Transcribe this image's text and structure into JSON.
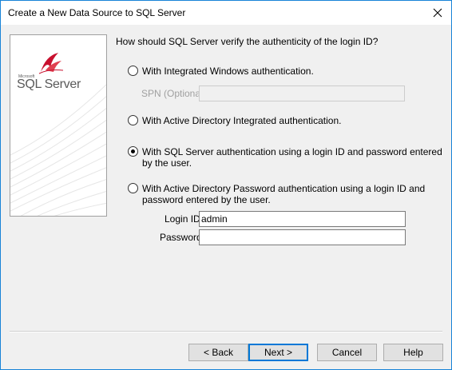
{
  "window": {
    "title": "Create a New Data Source to SQL Server"
  },
  "logo": {
    "small_text": "Microsoft",
    "product_text": "SQL Server"
  },
  "question": "How should SQL Server verify the authenticity of the login ID?",
  "options": [
    {
      "label": "With Integrated Windows authentication.",
      "checked": false
    },
    {
      "label": "With Active Directory Integrated authentication.",
      "checked": false
    },
    {
      "label_line1": "With SQL Server authentication using a login ID and password entered",
      "label_line2": "by the user.",
      "checked": true
    },
    {
      "label_line1": "With Active Directory Password authentication using a login ID and",
      "label_line2": "password entered by the user.",
      "checked": false
    }
  ],
  "spn": {
    "label": "SPN (Optional):",
    "value": ""
  },
  "login_id": {
    "label": "Login ID:",
    "value": "admin"
  },
  "password": {
    "label": "Password:",
    "value": ""
  },
  "buttons": {
    "back": "< Back",
    "next": "Next >",
    "cancel": "Cancel",
    "help": "Help"
  },
  "colors": {
    "accent": "#0078d7",
    "logo_red": "#c8102e",
    "dialog_bg": "#f0f0f0"
  }
}
